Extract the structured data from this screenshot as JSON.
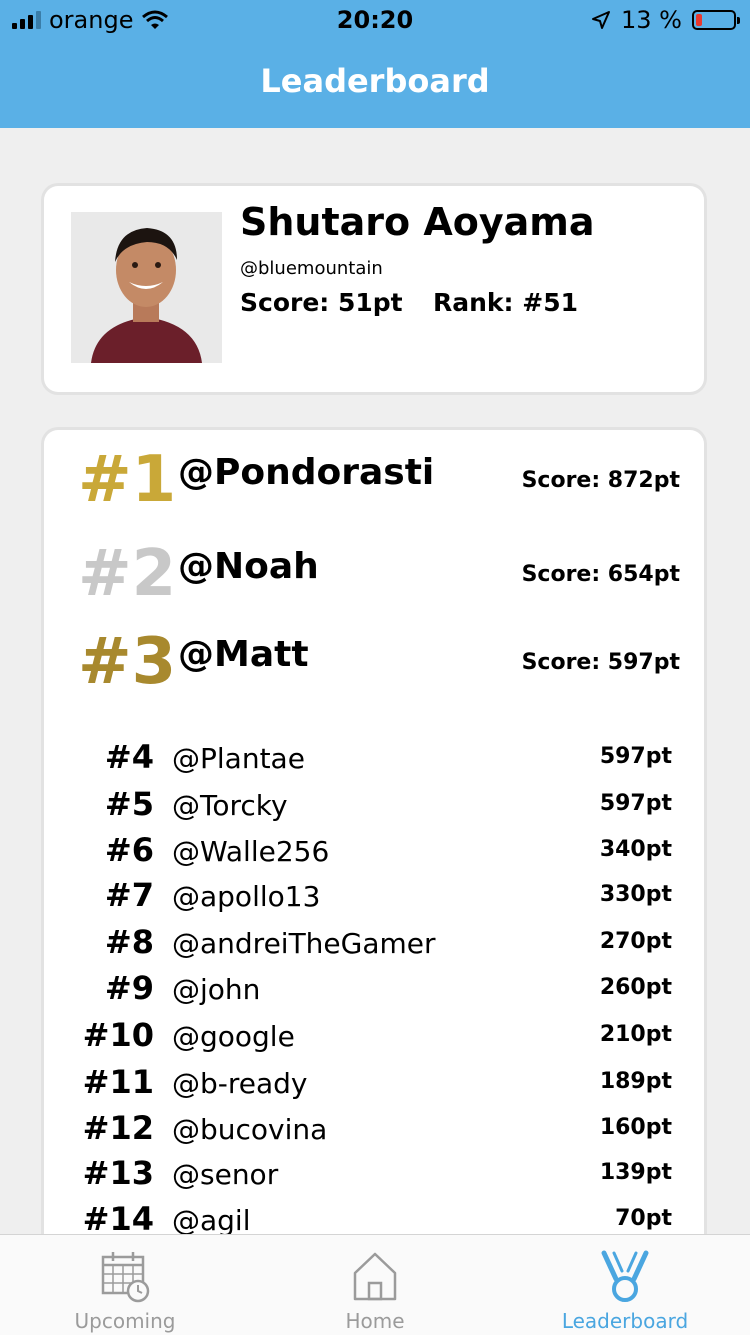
{
  "status_bar": {
    "carrier": "orange",
    "time": "20:20",
    "battery_percent": "13 %"
  },
  "header": {
    "title": "Leaderboard"
  },
  "profile": {
    "name": "Shutaro Aoyama",
    "handle": "@bluemountain",
    "score": "Score: 51pt",
    "rank": "Rank: #51"
  },
  "podium": [
    {
      "rank": "#1",
      "name": "@Pondorasti",
      "score": "Score: 872pt",
      "color": "#c9a838"
    },
    {
      "rank": "#2",
      "name": "@Noah",
      "score": "Score: 654pt",
      "color": "#c8c8c8"
    },
    {
      "rank": "#3",
      "name": "@Matt",
      "score": "Score: 597pt",
      "color": "#a8892e"
    }
  ],
  "rows": [
    {
      "rank": "#4",
      "name": "@Plantae",
      "score": "597pt"
    },
    {
      "rank": "#5",
      "name": "@Torcky",
      "score": "597pt"
    },
    {
      "rank": "#6",
      "name": "@Walle256",
      "score": "340pt"
    },
    {
      "rank": "#7",
      "name": "@apollo13",
      "score": "330pt"
    },
    {
      "rank": "#8",
      "name": "@andreiTheGamer",
      "score": "270pt"
    },
    {
      "rank": "#9",
      "name": "@john",
      "score": "260pt"
    },
    {
      "rank": "#10",
      "name": "@google",
      "score": "210pt"
    },
    {
      "rank": "#11",
      "name": "@b-ready",
      "score": "189pt"
    },
    {
      "rank": "#12",
      "name": "@bucovina",
      "score": "160pt"
    },
    {
      "rank": "#13",
      "name": "@senor",
      "score": "139pt"
    },
    {
      "rank": "#14",
      "name": "@agil",
      "score": "70pt"
    }
  ],
  "tabs": [
    {
      "label": "Upcoming",
      "icon": "calendar-clock-icon"
    },
    {
      "label": "Home",
      "icon": "house-icon"
    },
    {
      "label": "Leaderboard",
      "icon": "medal-icon",
      "active": true
    }
  ],
  "colors": {
    "accent": "#5ab0e6",
    "active_tab": "#4aa6e0",
    "background": "#efefef"
  }
}
